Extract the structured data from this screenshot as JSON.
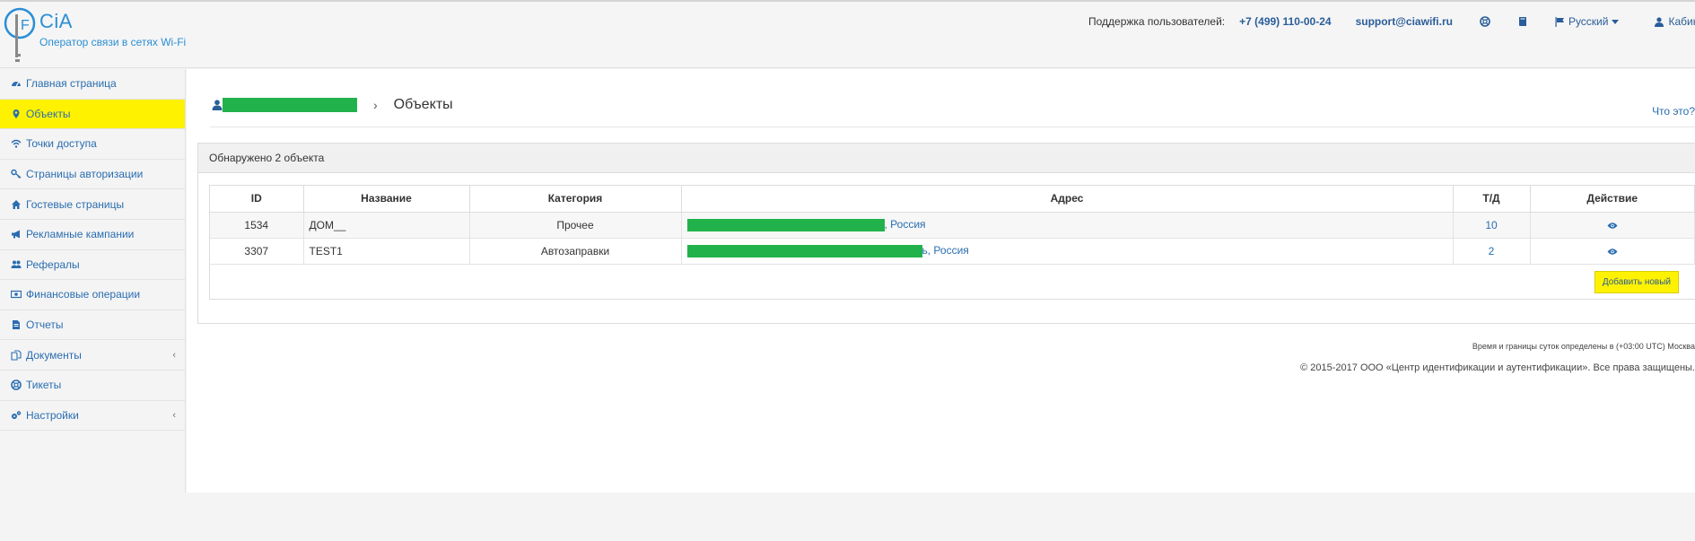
{
  "brand": {
    "name": "CiA",
    "subtitle": "Оператор связи в сетях Wi-Fi"
  },
  "header": {
    "support_label": "Поддержка пользователей:",
    "phone": "+7 (499) 110-00-24",
    "email": "support@ciawifi.ru",
    "language": "Русский",
    "cabinet": "Кабинет"
  },
  "sidebar": {
    "items": [
      {
        "label": "Главная страница",
        "icon": "dashboard-icon"
      },
      {
        "label": "Объекты",
        "icon": "map-marker-icon",
        "active": true
      },
      {
        "label": "Точки доступа",
        "icon": "wifi-icon"
      },
      {
        "label": "Страницы авторизации",
        "icon": "key-icon"
      },
      {
        "label": "Гостевые страницы",
        "icon": "home-icon"
      },
      {
        "label": "Рекламные кампании",
        "icon": "megaphone-icon"
      },
      {
        "label": "Рефералы",
        "icon": "users-icon"
      },
      {
        "label": "Финансовые операции",
        "icon": "money-icon"
      },
      {
        "label": "Отчеты",
        "icon": "file-icon"
      },
      {
        "label": "Документы",
        "icon": "documents-icon",
        "has_submenu": true
      },
      {
        "label": "Тикеты",
        "icon": "lifebuoy-icon"
      },
      {
        "label": "Настройки",
        "icon": "cogs-icon",
        "has_submenu": true
      }
    ]
  },
  "breadcrumb": {
    "current": "Объекты",
    "help": "Что это?"
  },
  "panel": {
    "found_text": "Обнаружено 2 объекта"
  },
  "table": {
    "columns": [
      "ID",
      "Название",
      "Категория",
      "Адрес",
      "Т/Д",
      "Действие"
    ],
    "rows": [
      {
        "id": "1534",
        "name": "ДОМ__",
        "category": "Прочее",
        "address_suffix": ", Россия",
        "ap_count": "10"
      },
      {
        "id": "3307",
        "name": "TEST1",
        "category": "Автозаправки",
        "address_suffix": "ь, Россия",
        "ap_count": "2"
      }
    ],
    "add_button": "Добавить новый"
  },
  "footer": {
    "timezone_note": "Время и границы суток определены в (+03:00 UTC) Москва",
    "copyright": "© 2015-2017 ООО «Центр идентификации и аутентификации». Все права защищены."
  },
  "colors": {
    "accent_yellow": "#fff200",
    "link_blue": "#2a6db0",
    "brand_blue": "#2a8fd4",
    "redaction_green": "#22b24c"
  }
}
